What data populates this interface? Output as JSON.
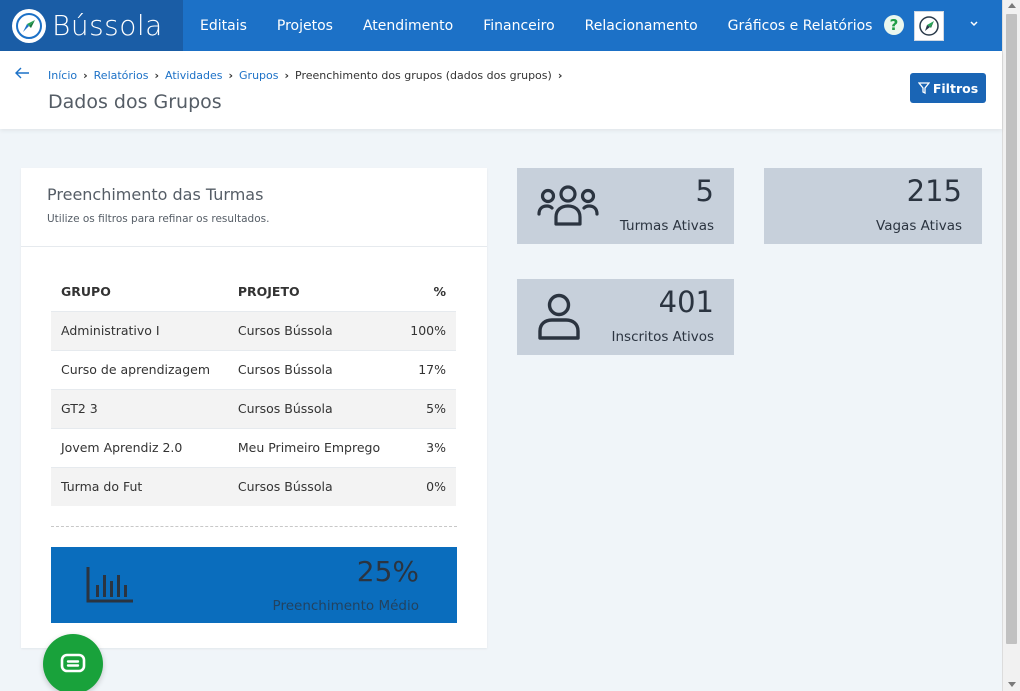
{
  "brand": {
    "name": "Bússola"
  },
  "nav": [
    "Editais",
    "Projetos",
    "Atendimento",
    "Financeiro",
    "Relacionamento",
    "Gráficos e Relatórios"
  ],
  "header": {
    "help_glyph": "?",
    "breadcrumb": [
      "Início",
      "Relatórios",
      "Atividades",
      "Grupos",
      "Preenchimento dos grupos (dados dos grupos)"
    ],
    "title": "Dados dos Grupos",
    "filter_label": "Filtros"
  },
  "card": {
    "title": "Preenchimento das Turmas",
    "subtitle": "Utilize os filtros para refinar os resultados.",
    "columns": [
      "GRUPO",
      "PROJETO",
      "%"
    ],
    "rows": [
      [
        "Administrativo I",
        "Cursos Bússola",
        "100%"
      ],
      [
        "Curso de aprendizagem",
        "Cursos Bússola",
        "17%"
      ],
      [
        "GT2 3",
        "Cursos Bússola",
        "5%"
      ],
      [
        "Jovem Aprendiz 2.0",
        "Meu Primeiro Emprego",
        "3%"
      ],
      [
        "Turma do Fut",
        "Cursos Bússola",
        "0%"
      ]
    ],
    "average": {
      "value": "25%",
      "label": "Preenchimento Médio"
    }
  },
  "stats": {
    "turmas": {
      "value": "5",
      "label": "Turmas Ativas"
    },
    "vagas": {
      "value": "215",
      "label": "Vagas Ativas"
    },
    "inscritos": {
      "value": "401",
      "label": "Inscritos Ativos"
    }
  },
  "colors": {
    "primary": "#1c71c7",
    "brand_dark": "#1a5da6",
    "stat_bg": "#c7d0db",
    "average_bg": "#0a6dbd",
    "chat": "#19a23b"
  }
}
